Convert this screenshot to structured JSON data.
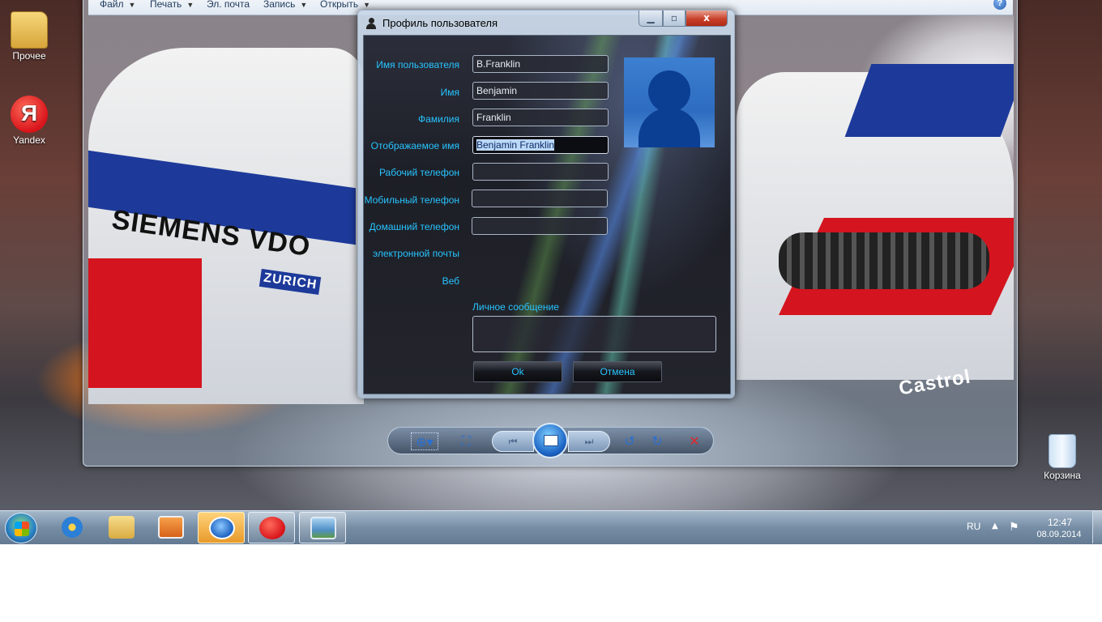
{
  "desktop": {
    "icons": [
      {
        "label": "Прочее"
      },
      {
        "label": "Yandex",
        "glyph": "Я"
      },
      {
        "label": "Корзина"
      }
    ]
  },
  "viewer": {
    "menu": [
      {
        "label": "Файл"
      },
      {
        "label": "Печать"
      },
      {
        "label": "Эл. почта"
      },
      {
        "label": "Запись"
      },
      {
        "label": "Открыть"
      }
    ],
    "help_glyph": "?",
    "photo_sponsors": [
      "SIEMENS VDO",
      "ZURICH",
      "Castrol"
    ],
    "toolbar": {
      "zoom_glyph": "⊕▾",
      "fit_glyph": "⛶",
      "prev_glyph": "⏮",
      "next_glyph": "⏭",
      "rotate_ccw_glyph": "↺",
      "rotate_cw_glyph": "↻",
      "delete_glyph": "✕"
    }
  },
  "dialog": {
    "title": "Профиль пользователя",
    "close_glyph": "x",
    "fields": {
      "username": {
        "label": "Имя пользователя",
        "value": "B.Franklin"
      },
      "first_name": {
        "label": "Имя",
        "value": "Benjamin"
      },
      "last_name": {
        "label": "Фамилия",
        "value": "Franklin"
      },
      "display_name": {
        "label": "Отображаемое имя",
        "value": "Benjamin  Franklin"
      },
      "work_phone": {
        "label": "Рабочий телефон",
        "value": ""
      },
      "mobile_phone": {
        "label": "Мобильный телефон",
        "value": ""
      },
      "home_phone": {
        "label": "Домашний телефон",
        "value": ""
      },
      "email": {
        "label": "электронной почты"
      },
      "web": {
        "label": "Веб"
      }
    },
    "personal_message_label": "Личное сообщение",
    "personal_message_value": "",
    "ok_label": "Ok",
    "cancel_label": "Отмена"
  },
  "taskbar": {
    "language": "RU",
    "time": "12:47",
    "date": "08.09.2014",
    "tray_arrow": "▲",
    "tray_flag": "⚑"
  },
  "colors": {
    "label_accent": "#27c4ff",
    "close_red": "#c7402a"
  }
}
